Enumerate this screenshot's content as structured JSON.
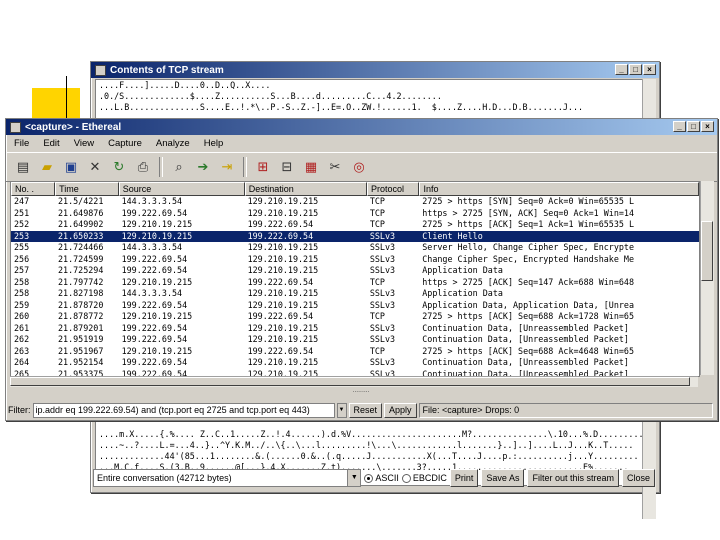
{
  "stream_window": {
    "title": "Contents of TCP stream",
    "top_text": [
      "....F....].....D....0..D..Q..X....",
      ".0./S.............$....Z..........S...B....d.........C...4.2........",
      "...L.B..............S....E..!.*\\..P.-S..Z.-]..E=.O..ZW.!......1.  $....Z....H.D...D.B.......J..."
    ],
    "bottom_text": [
      "....m.X.....{.%.... Z..C..1.....Z..!.4......).d.%V......................M?...............\\.10...%.D..........?.",
      "....~..?....L.=...4..}..^Y.K.M../..\\{..\\...l.........!\\...\\............l.......}..]..]....L..J...K..T.....",
      ".............44'(85...1........&.(......0.&..(.q.....J...........X(...T....J....p.:..........j...Y.........",
      "...M.C.f....S.(3.B..9......@[...}.4.X.......Z.t).......\\.......3?.....1.........................E%......."
    ],
    "conversation": "Entire conversation (42712 bytes)",
    "radio_options": [
      "ASCII",
      "EBCDIC"
    ],
    "buttons": [
      "Print",
      "Save As",
      "Filter out this stream",
      "Close"
    ]
  },
  "ethereal_window": {
    "title": "<capture> - Ethereal",
    "menu": [
      "File",
      "Edit",
      "View",
      "Capture",
      "Analyze",
      "Help"
    ],
    "columns": [
      "No. .",
      "Time",
      "Source",
      "Destination",
      "Protocol",
      "Info"
    ],
    "rows": [
      [
        "247",
        "21.5/4221",
        "144.3.3.3.54",
        "129.210.19.215",
        "TCP",
        "2725 > https [SYN] Seq=0 Ack=0 Win=65535 L"
      ],
      [
        "251",
        "21.649876",
        "199.222.69.54",
        "129.210.19.215",
        "TCP",
        "https > 2725 [SYN, ACK] Seq=0 Ack=1 Win=14"
      ],
      [
        "252",
        "21.649902",
        "129.210.19.215",
        "199.222.69.54",
        "TCP",
        "2725 > https [ACK] Seq=1 Ack=1 Win=65535 L"
      ],
      [
        "253",
        "21.650233",
        "129.210.19.215",
        "199.222.69.54",
        "SSLv3",
        "Client Hello"
      ],
      [
        "255",
        "21.724466",
        "144.3.3.3.54",
        "129.210.19.215",
        "SSLv3",
        "Server Hello, Change Cipher Spec, Encrypte"
      ],
      [
        "256",
        "21.724599",
        "199.222.69.54",
        "129.210.19.215",
        "SSLv3",
        "Change Cipher Spec, Encrypted Handshake Me"
      ],
      [
        "257",
        "21.725294",
        "199.222.69.54",
        "129.210.19.215",
        "SSLv3",
        "Application Data"
      ],
      [
        "258",
        "21.797742",
        "129.210.19.215",
        "199.222.69.54",
        "TCP",
        "https > 2725 [ACK] Seq=147 Ack=688 Win=648"
      ],
      [
        "258",
        "21.827198",
        "144.3.3.3.54",
        "129.210.19.215",
        "SSLv3",
        "Application Data"
      ],
      [
        "259",
        "21.878720",
        "199.222.69.54",
        "129.210.19.215",
        "SSLv3",
        "Application Data, Application Data, [Unrea"
      ],
      [
        "260",
        "21.878772",
        "129.210.19.215",
        "199.222.69.54",
        "TCP",
        "2725 > https [ACK] Seq=688 Ack=1728 Win=65"
      ],
      [
        "261",
        "21.879201",
        "199.222.69.54",
        "129.210.19.215",
        "SSLv3",
        "Continuation Data, [Unreassembled Packet]"
      ],
      [
        "262",
        "21.951919",
        "199.222.69.54",
        "129.210.19.215",
        "SSLv3",
        "Continuation Data, [Unreassembled Packet]"
      ],
      [
        "263",
        "21.951967",
        "129.210.19.215",
        "199.222.69.54",
        "TCP",
        "2725 > https [ACK] Seq=688 Ack=4648 Win=65"
      ],
      [
        "264",
        "21.952154",
        "199.222.69.54",
        "129.210.19.215",
        "SSLv3",
        "Continuation Data, [Unreassembled Packet]"
      ],
      [
        "265",
        "21.953375",
        "199.222.69.54",
        "129.210.19.215",
        "SSLv3",
        "Continuation Data, [Unreassembled Packet]"
      ]
    ],
    "selected_row_index": 3,
    "filter_label": "Filter:",
    "filter_value": "ip.addr eq 199.222.69.54) and (tcp.port eq 2725 and tcp.port eq 443)",
    "reset_label": "Reset",
    "apply_label": "Apply",
    "status": "File: <capture> Drops: 0"
  },
  "colors": {
    "title_start": "#0a246a",
    "title_end": "#a6caf0",
    "selection": "#0a246a",
    "deco_yellow": "#ffd400",
    "deco_red": "#d51f1f"
  }
}
